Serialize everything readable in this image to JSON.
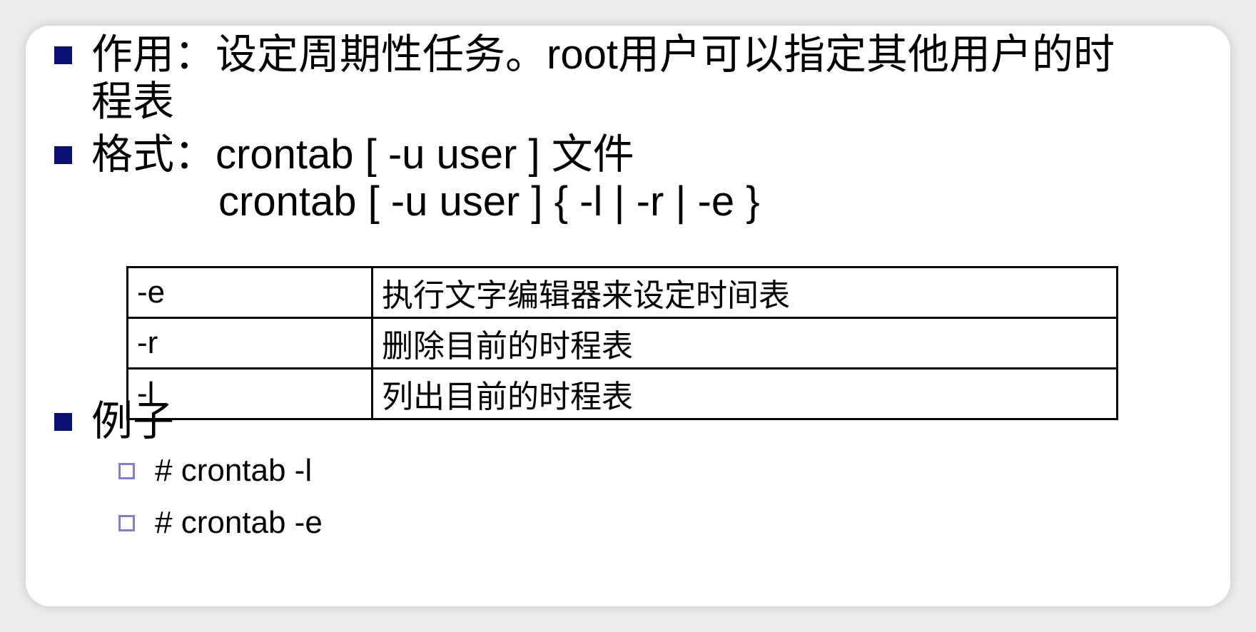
{
  "slide": {
    "purpose": {
      "label": "作用：",
      "text_line1": "设定周期性任务。root用户可以指定其他用户的时",
      "text_line2": "程表"
    },
    "format": {
      "label": "格式：",
      "syntax1_code": "crontab [ -u user ] ",
      "syntax1_word": "文件",
      "syntax2": "crontab [ -u user ] { -l | -r | -e }"
    },
    "options_table": [
      {
        "option": "-e",
        "description": "执行文字编辑器来设定时间表"
      },
      {
        "option": "-r",
        "description": "删除目前的时程表"
      },
      {
        "option": "-l",
        "description": "列出目前的时程表"
      }
    ],
    "examples": {
      "label": "例子",
      "items": [
        "# crontab -l",
        "# crontab -e"
      ]
    }
  },
  "colors": {
    "bullet": "#0a1172",
    "sub_bullet": "#8080c8"
  }
}
